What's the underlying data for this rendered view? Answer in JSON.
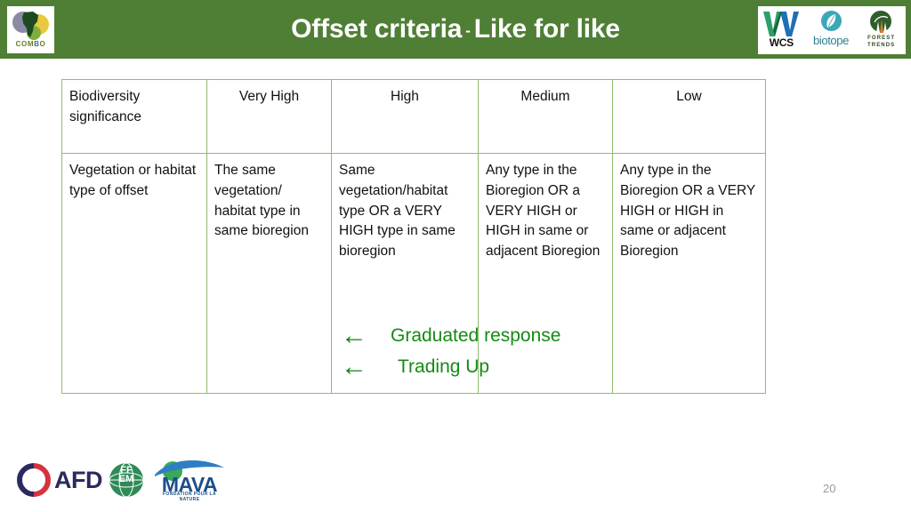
{
  "slide": {
    "title_main": "Offset criteria",
    "title_dash": "-",
    "title_sub": "Like for like",
    "number": "20",
    "header_color": "#4f7f35",
    "table_border_color": "#8fbc6e",
    "annotation_color": "#158a15"
  },
  "logos": {
    "combo": {
      "name": "COMBO",
      "word_part1": "COM",
      "word_part2": "B",
      "word_part3": "O"
    },
    "wcs": {
      "name": "WCS"
    },
    "biotope": {
      "name": "biotope"
    },
    "forest_trends": {
      "line1": "FOREST",
      "line2": "TRENDS"
    },
    "afd": {
      "name": "AFD"
    },
    "ffem": {
      "line1": "FF",
      "line2": "EM"
    },
    "mava": {
      "name": "MAVA",
      "tagline": "FONDATION POUR LA NATURE"
    }
  },
  "table": {
    "headers": [
      "Biodiversity significance",
      "Very High",
      "High",
      "Medium",
      "Low"
    ],
    "rows": [
      {
        "label": "Vegetation or habitat type of offset",
        "cells": [
          "The same vegetation/ habitat type in same bioregion",
          "Same vegetation/habitat type OR a VERY HIGH type in same bioregion",
          "Any type in the Bioregion OR a VERY HIGH or HIGH in same or adjacent Bioregion",
          "Any type in the Bioregion OR a VERY HIGH or HIGH in same or adjacent Bioregion"
        ]
      }
    ]
  },
  "annotations": [
    {
      "arrow": "←",
      "label": "Graduated response"
    },
    {
      "arrow": "←",
      "label": "Trading Up"
    }
  ]
}
